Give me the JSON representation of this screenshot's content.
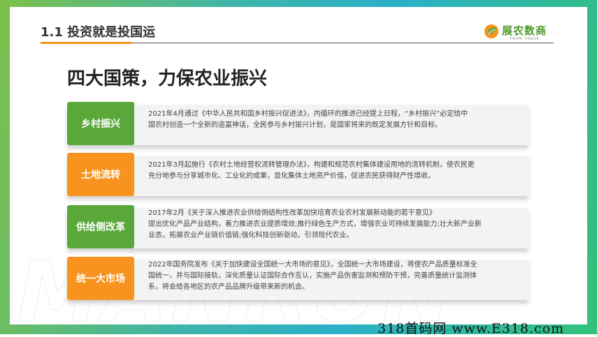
{
  "header": {
    "section_title": "1.1 投资就是投国运",
    "logo_text": "展农数商",
    "logo_sub": "FARM TRADE"
  },
  "headline": "四大国策，力保农业振兴",
  "items": [
    {
      "label": "乡村振兴",
      "desc_lines": [
        "2021年4月通过《中华人民共和国乡村振兴促进法》，内循环的推进已经提上日程，“乡村振兴”必定给中",
        "国农村创造一个全新的造富神话，全民参与乡村振兴计划，是国家将来的既定发展方针和目标。"
      ]
    },
    {
      "label": "土地流转",
      "desc_lines": [
        "2021年3月起施行《农村土地经营权流转管理办法》，构建和规范农村集体建设用地的流转机制，使农民更",
        "充分地参与分享城市化、工业化的成果，显化集体土地资产价值，促进农民获得财产性增收。"
      ]
    },
    {
      "label": "供给侧改革",
      "desc_lines": [
        "2017年2月《关于深入推进农业供给侧结构性改革加快培育农业农村发展新动能的若干意见》",
        "提出优化产品产业结构，着力推进农业提质增效;推行绿色生产方式，增强农业可持续发展能力;壮大新产业新",
        "业态，拓展农业产业链价值链;强化科技创新驱动，引领现代农业。"
      ]
    },
    {
      "label": "统一大市场",
      "desc_lines": [
        "2022年国务院发布《关于加快建设全国统一大市场的意见》，全国统一大市场建设，将使农产品质量标准全",
        "国统一，并与国际接轨，深化质量认证国际合作互认，实施产品伤害监测和预防干预，完善质量统计监测体",
        "系，将会给各地区的农产品品牌升级带来新的机会。"
      ]
    }
  ],
  "footer_watermark": "318首码网 www.E318.com"
}
